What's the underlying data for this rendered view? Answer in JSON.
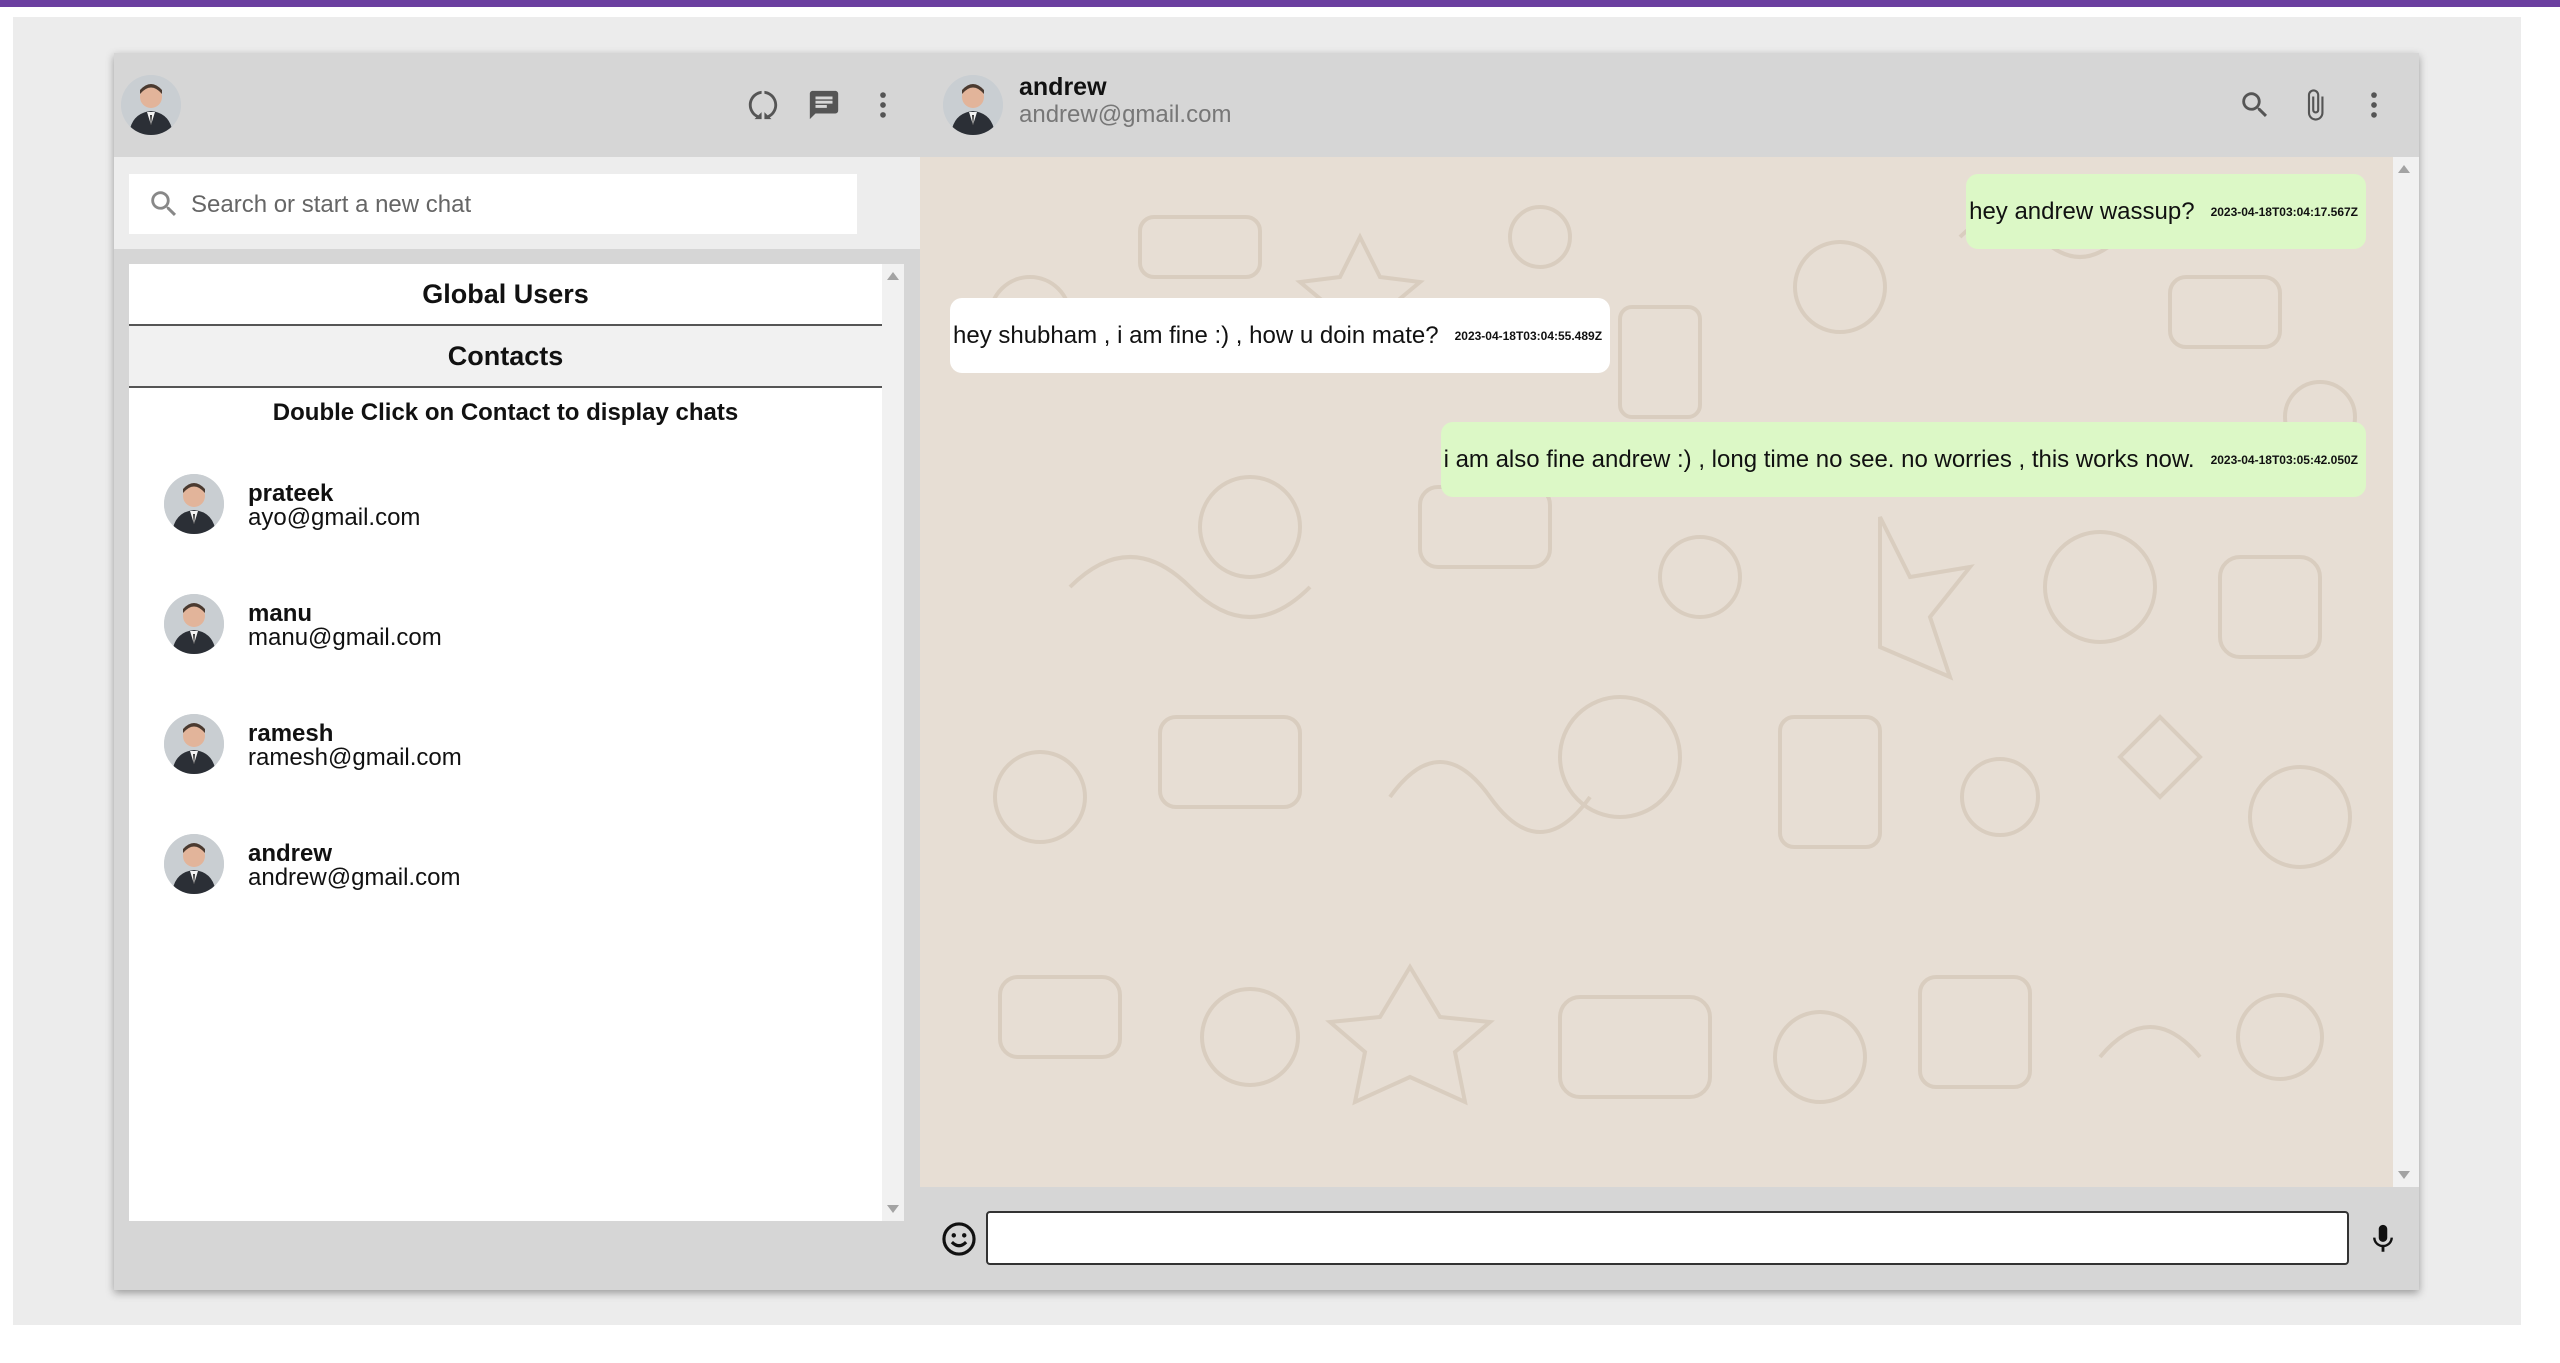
{
  "left_header": {
    "icons": [
      "status-icon",
      "new-chat-icon",
      "menu-icon"
    ]
  },
  "search": {
    "placeholder": "Search or start a new chat"
  },
  "tabs": {
    "global": "Global Users",
    "contacts": "Contacts"
  },
  "hint": "Double Click on Contact to display chats",
  "contacts": [
    {
      "name": "prateek",
      "email": "ayo@gmail.com"
    },
    {
      "name": "manu",
      "email": "manu@gmail.com"
    },
    {
      "name": "ramesh",
      "email": "ramesh@gmail.com"
    },
    {
      "name": "andrew",
      "email": "andrew@gmail.com"
    }
  ],
  "chat_header": {
    "name": "andrew",
    "email": "andrew@gmail.com",
    "icons": [
      "search-icon",
      "attach-icon",
      "menu-icon"
    ]
  },
  "messages": [
    {
      "direction": "out",
      "text": "hey andrew wassup?",
      "timestamp": "2023-04-18T03:04:17.567Z"
    },
    {
      "direction": "in",
      "text": "hey shubham , i am fine :) , how u doin mate?",
      "timestamp": "2023-04-18T03:04:55.489Z"
    },
    {
      "direction": "out",
      "text": "i am also fine andrew :) , long time no see. no worries , this works now.",
      "timestamp": "2023-04-18T03:05:42.050Z"
    }
  ],
  "composer": {
    "value": "",
    "icons": [
      "emoji-icon",
      "mic-icon"
    ]
  },
  "colors": {
    "accent_bar": "#6b3fa0",
    "outgoing_bubble": "#dcf8c6",
    "incoming_bubble": "#ffffff",
    "chat_background": "#e7ded4",
    "header_background": "#d6d6d6"
  }
}
